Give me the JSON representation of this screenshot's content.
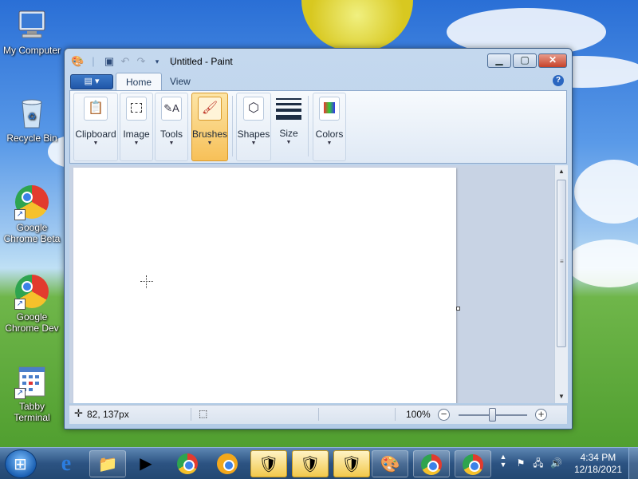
{
  "desktop": {
    "icons": [
      {
        "label": "My Computer",
        "icon": "computer-icon"
      },
      {
        "label": "Recycle Bin",
        "icon": "recycle-bin-icon"
      },
      {
        "label": "Google Chrome Beta",
        "icon": "chrome-beta-icon",
        "badge": "Beta"
      },
      {
        "label": "Google Chrome Dev",
        "icon": "chrome-dev-icon",
        "badge": "Dev"
      },
      {
        "label": "Tabby Terminal",
        "icon": "tabby-terminal-icon"
      }
    ]
  },
  "window": {
    "title": "Untitled - Paint",
    "tabs": [
      "Home",
      "View"
    ],
    "active_tab": "Home",
    "ribbon_groups": [
      {
        "label": "Clipboard",
        "icon": "clipboard-icon"
      },
      {
        "label": "Image",
        "icon": "select-icon"
      },
      {
        "label": "Tools",
        "icon": "tools-icon"
      },
      {
        "label": "Brushes",
        "icon": "brush-icon",
        "active": true
      },
      {
        "label": "Shapes",
        "icon": "shapes-icon"
      },
      {
        "label": "Size",
        "icon": "size-icon"
      },
      {
        "label": "Colors",
        "icon": "colors-icon"
      }
    ],
    "status": {
      "cursor_position": "82, 137px",
      "zoom": "100%"
    }
  },
  "taskbar": {
    "items": [
      {
        "name": "internet-explorer",
        "icon": "ie-icon"
      },
      {
        "name": "file-explorer",
        "icon": "folder-icon"
      },
      {
        "name": "media-player",
        "icon": "media-player-icon"
      },
      {
        "name": "google-chrome",
        "icon": "chrome-icon"
      },
      {
        "name": "google-chrome-canary",
        "icon": "chrome-canary-icon"
      },
      {
        "name": "security-1",
        "icon": "shield-icon"
      },
      {
        "name": "security-2",
        "icon": "shield-icon"
      },
      {
        "name": "security-3",
        "icon": "shield-icon"
      },
      {
        "name": "paint",
        "icon": "paint-icon"
      },
      {
        "name": "chrome-beta",
        "icon": "chrome-beta-icon"
      },
      {
        "name": "chrome-dev",
        "icon": "chrome-dev-icon"
      }
    ],
    "clock": {
      "time": "4:34 PM",
      "date": "12/18/2021"
    }
  }
}
